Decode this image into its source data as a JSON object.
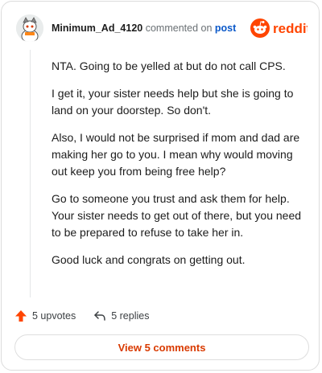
{
  "comment": {
    "username": "Minimum_Ad_4120",
    "action_text": "commented on",
    "post_link": "post",
    "brand_name": "reddit",
    "avatar_icon": "snoo-avatar-icon",
    "paragraphs": [
      "NTA. Going to be yelled at but do not call CPS.",
      "I get it, your sister needs help but she is going to land on your doorstep. So don't.",
      "Also, I would not be surprised if mom and dad are making her go to you. I mean why would moving out keep you from being free help?",
      "Go to someone you trust and ask them for help. Your sister needs to get out of there, but you need to be prepared to refuse to take her in.",
      "Good luck and congrats on getting out."
    ]
  },
  "actions": {
    "upvotes_label": "5 upvotes",
    "replies_label": "5 replies",
    "view_comments_label": "View 5 comments"
  },
  "colors": {
    "brand_orange": "#ff4500",
    "link_blue": "#0a58c9",
    "accent_text": "#d93a00"
  }
}
